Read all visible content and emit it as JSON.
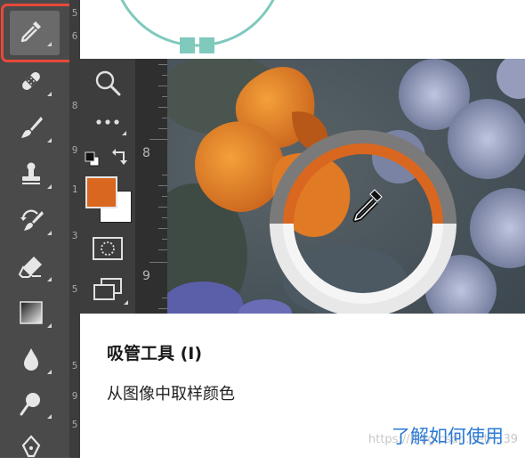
{
  "tooltip": {
    "title": "吸管工具 (I)",
    "description": "从图像中取样颜色",
    "learn_link": "了解如何使用"
  },
  "watermark": "https://blog.csdn.net/...39",
  "rulers": {
    "left_digits": [
      "5",
      "6",
      "8",
      "9",
      "1",
      "3",
      "5",
      "5",
      "9",
      "5"
    ],
    "secondary_digits": [
      "8",
      "9"
    ]
  },
  "colors": {
    "foreground": "#d9671f",
    "background": "#ffffff",
    "highlight": "#e8493a",
    "link": "#2b7ad6",
    "accent_teal": "#7fc9bd"
  },
  "tools_main": [
    "eyedropper-icon",
    "healing-brush-icon",
    "brush-icon",
    "clone-stamp-icon",
    "history-brush-icon",
    "eraser-icon",
    "gradient-icon",
    "blur-drop-icon",
    "dodge-icon",
    "pen-icon"
  ],
  "tools_secondary": [
    "zoom-icon",
    "more-icon",
    "default-colors-icon",
    "swap-colors-icon",
    "quick-mask-icon",
    "screen-mode-icon"
  ]
}
